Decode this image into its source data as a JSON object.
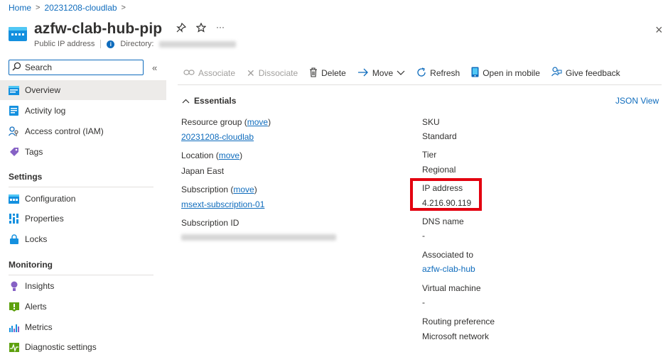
{
  "breadcrumb": {
    "home": "Home",
    "resource": "20231208-cloudlab"
  },
  "header": {
    "title": "azfw-clab-hub-pip",
    "resource_type": "Public IP address",
    "directory_label": "Directory:",
    "close_label": "×"
  },
  "search": {
    "placeholder": "Search"
  },
  "sidebar": {
    "collapse_label": "«",
    "items": [
      {
        "label": "Overview",
        "icon": "overview-icon"
      },
      {
        "label": "Activity log",
        "icon": "activity-log-icon"
      },
      {
        "label": "Access control (IAM)",
        "icon": "iam-icon"
      },
      {
        "label": "Tags",
        "icon": "tag-icon"
      }
    ],
    "settings_heading": "Settings",
    "settings_items": [
      {
        "label": "Configuration",
        "icon": "configuration-icon"
      },
      {
        "label": "Properties",
        "icon": "properties-icon"
      },
      {
        "label": "Locks",
        "icon": "lock-icon"
      }
    ],
    "monitoring_heading": "Monitoring",
    "monitoring_items": [
      {
        "label": "Insights",
        "icon": "insights-icon"
      },
      {
        "label": "Alerts",
        "icon": "alerts-icon"
      },
      {
        "label": "Metrics",
        "icon": "metrics-icon"
      },
      {
        "label": "Diagnostic settings",
        "icon": "diagnostic-settings-icon"
      }
    ]
  },
  "toolbar": {
    "associate": "Associate",
    "dissociate": "Dissociate",
    "delete": "Delete",
    "move": "Move",
    "refresh": "Refresh",
    "open_in_mobile": "Open in mobile",
    "give_feedback": "Give feedback"
  },
  "essentials": {
    "heading": "Essentials",
    "json_view": "JSON View",
    "resource_group_label": "Resource group",
    "move_link": "move",
    "resource_group_value": "20231208-cloudlab",
    "location_label": "Location",
    "location_value": "Japan East",
    "subscription_label": "Subscription",
    "subscription_value": "msext-subscription-01",
    "subscription_id_label": "Subscription ID",
    "sku_label": "SKU",
    "sku_value": "Standard",
    "tier_label": "Tier",
    "tier_value": "Regional",
    "ip_label": "IP address",
    "ip_value": "4.216.90.119",
    "dns_label": "DNS name",
    "dns_value": "-",
    "associated_label": "Associated to",
    "associated_value": "azfw-clab-hub",
    "vm_label": "Virtual machine",
    "vm_value": "-",
    "routing_label": "Routing preference",
    "routing_value": "Microsoft network"
  },
  "colors": {
    "accent": "#0f6cbd",
    "highlight": "#e3000f",
    "active_nav": "#edebe9"
  }
}
